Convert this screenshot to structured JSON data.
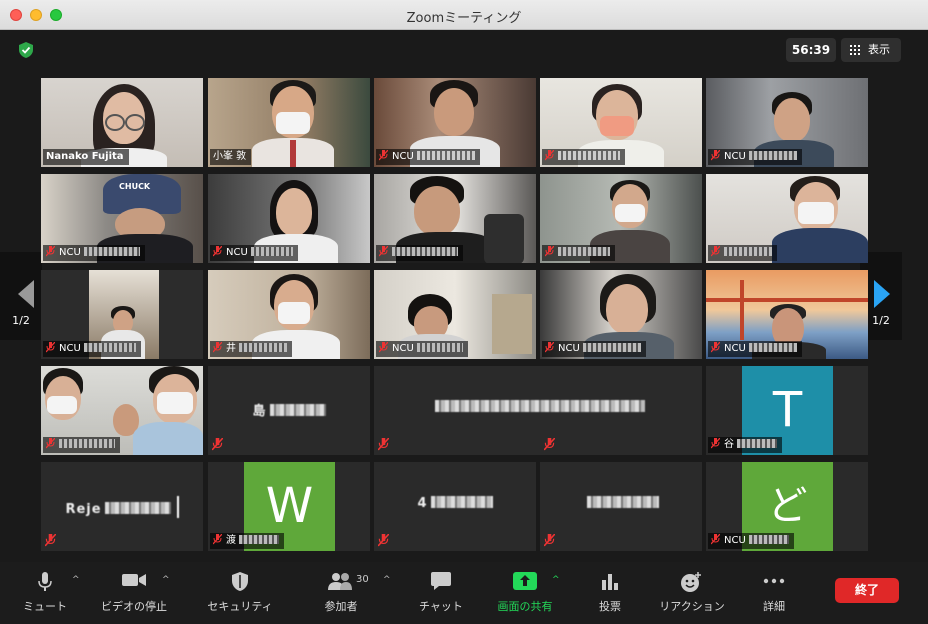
{
  "window": {
    "title": "Zoomミーティング"
  },
  "meeting": {
    "timer": "56:39",
    "view_label": "表示"
  },
  "nav": {
    "left_page": "1/2",
    "right_page": "1/2"
  },
  "tiles": {
    "t1": "Nanako Fujita",
    "t2": "小峯 敦",
    "t3": "NCU",
    "t5": "NCU",
    "t6": "NCU",
    "t7": "NCU",
    "t11": "NCU",
    "t12": "井",
    "t13": "NCU",
    "t14": "NCU",
    "t15": "NCU",
    "t17": "島",
    "t19": "谷",
    "t19_avatar": "T",
    "t20": "Reje",
    "t21": "渡",
    "t21_avatar": "W",
    "t22": "4",
    "t24": "NCU",
    "t24_avatar": "ど"
  },
  "toolbar": {
    "mute": "ミュート",
    "video": "ビデオの停止",
    "security": "セキュリティ",
    "participants": "参加者",
    "participants_count": "30",
    "chat": "チャット",
    "share": "画面の共有",
    "poll": "投票",
    "reaction": "リアクション",
    "more": "詳細",
    "end": "終了"
  },
  "colors": {
    "active_border": "#d7e36b",
    "share_green": "#23d959",
    "end_red": "#e02828",
    "avatar_teal": "#1e8fa8",
    "avatar_green": "#5fa83a",
    "nav_blue": "#2aa4f4"
  }
}
